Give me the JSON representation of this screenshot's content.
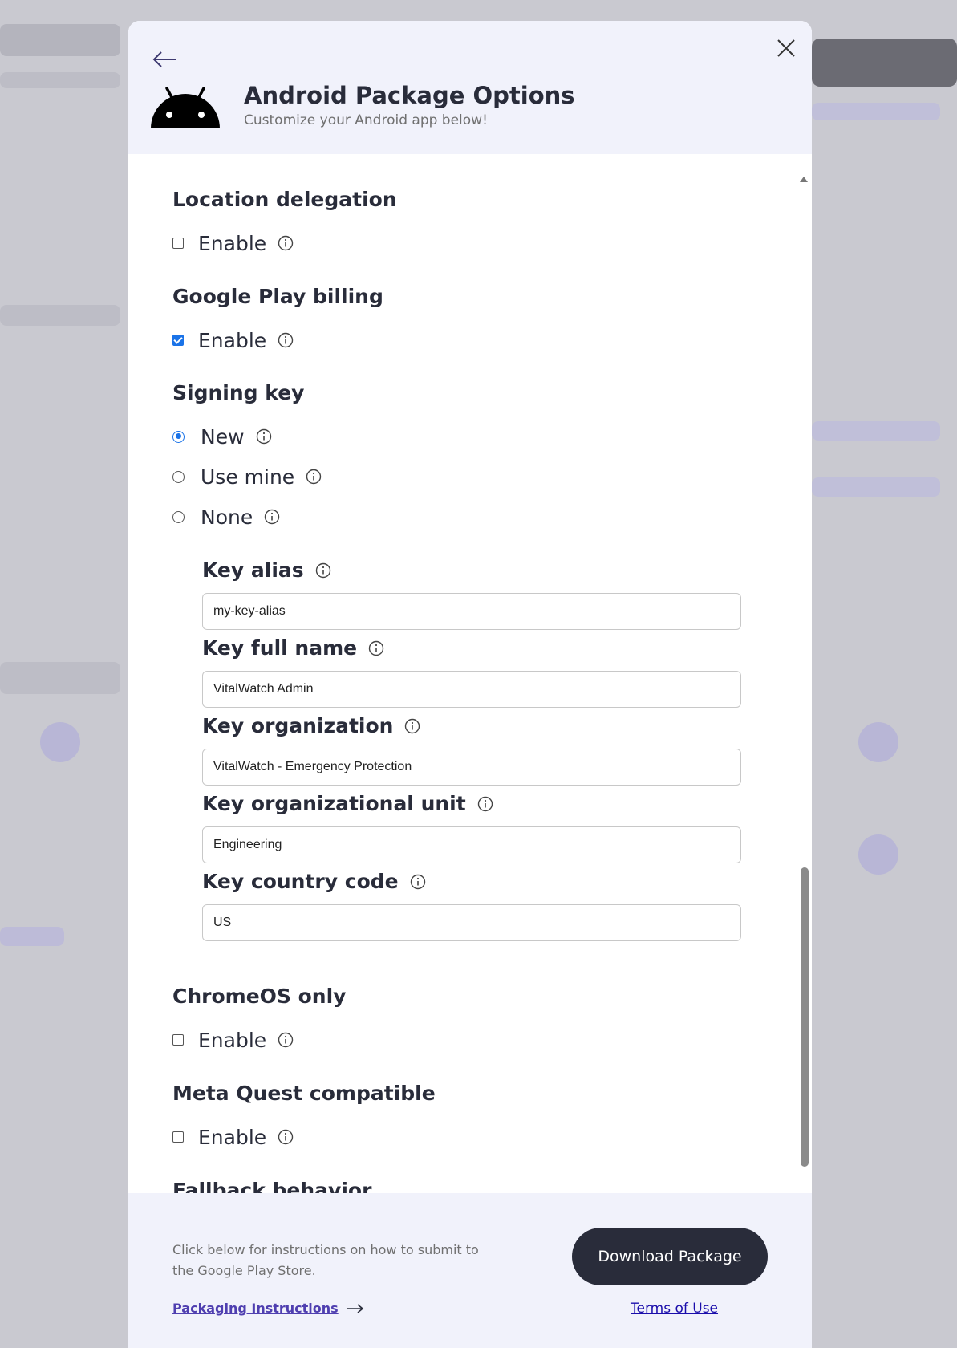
{
  "header": {
    "title": "Android Package Options",
    "subtitle": "Customize your Android app below!",
    "back_icon": "arrow-left-icon",
    "close_icon": "close-icon",
    "logo_icon": "android-logo-icon"
  },
  "sections": {
    "location_delegation": {
      "title": "Location delegation",
      "option_label": "Enable",
      "checked": false
    },
    "google_play_billing": {
      "title": "Google Play billing",
      "option_label": "Enable",
      "checked": true
    },
    "signing_key": {
      "title": "Signing key",
      "options": [
        {
          "label": "New",
          "selected": true
        },
        {
          "label": "Use mine",
          "selected": false
        },
        {
          "label": "None",
          "selected": false
        }
      ]
    },
    "chromeos_only": {
      "title": "ChromeOS only",
      "option_label": "Enable",
      "checked": false
    },
    "meta_quest": {
      "title": "Meta Quest compatible",
      "option_label": "Enable",
      "checked": false
    },
    "fallback": {
      "title": "Fallback behavior"
    }
  },
  "key_fields": {
    "alias": {
      "label": "Key alias",
      "value": "my-key-alias"
    },
    "full_name": {
      "label": "Key full name",
      "value": "VitalWatch Admin"
    },
    "organization": {
      "label": "Key organization",
      "value": "VitalWatch - Emergency Protection"
    },
    "org_unit": {
      "label": "Key organizational unit",
      "value": "Engineering"
    },
    "country_code": {
      "label": "Key country code",
      "value": "US"
    }
  },
  "footer": {
    "instructions_text": "Click below for instructions on how to submit to the Google Play Store.",
    "packaging_link": "Packaging Instructions",
    "download_button": "Download Package",
    "terms_link": "Terms of Use"
  },
  "colors": {
    "accent": "#1a73e8",
    "header_bg": "#f1f2fb",
    "dark_button": "#292c3a",
    "link_purple": "#4f3fb0"
  }
}
